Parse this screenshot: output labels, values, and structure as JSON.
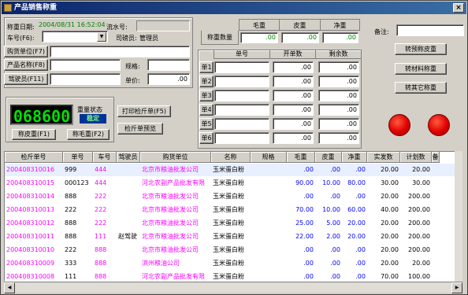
{
  "window": {
    "title": "产品销售称重",
    "close": "×"
  },
  "form": {
    "date_label": "称重日期:",
    "date_value": "2004/08/31 16:52:04",
    "serial_label": "流水号:",
    "serial_value": "",
    "car_label": "车号(F6):",
    "car_value": "",
    "operator_label": "司磅员:",
    "operator_value": "管理员",
    "buyer_label": "购货单位(F7)",
    "buyer_value": "",
    "product_label": "产品名称(F8)",
    "product_value": "",
    "spec_label": "规格:",
    "spec_value": "",
    "driver_label": "驾驶员(F11)",
    "driver_value": "",
    "price_label": "单价:",
    "price_value": ".00"
  },
  "weight_summary": {
    "headers": [
      "毛重",
      "皮重",
      "净重"
    ],
    "row_label": "称重数量",
    "values": [
      ".00",
      ".00",
      ".00"
    ]
  },
  "remark": {
    "label": "备注:",
    "value": ""
  },
  "detail_grid": {
    "headers": [
      "单号",
      "开单数",
      "剩余数"
    ],
    "rows": [
      {
        "label": "单1",
        "no": "",
        "open": ".00",
        "remain": ".00"
      },
      {
        "label": "单2",
        "no": "",
        "open": ".00",
        "remain": ".00"
      },
      {
        "label": "单3",
        "no": "",
        "open": ".00",
        "remain": ".00"
      },
      {
        "label": "单4",
        "no": "",
        "open": ".00",
        "remain": ".00"
      },
      {
        "label": "单5",
        "no": "",
        "open": ".00",
        "remain": ".00"
      },
      {
        "label": "单6",
        "no": "",
        "open": ".00",
        "remain": ".00"
      }
    ]
  },
  "scale": {
    "reading": "068600",
    "status_label": "重量状态",
    "status_value": "稳定",
    "tare_button": "称皮重(F1)",
    "gross_button": "称毛重(F2)"
  },
  "actions": {
    "print_ticket": "打印检斤单(F5)",
    "preview_ticket": "检斤单预览",
    "to_pre_tare": "转预称皮重",
    "to_material": "转材料称重",
    "to_other": "转其它称重"
  },
  "status_colors": {
    "light1": "#e00000",
    "light2": "#e00000",
    "lcd": "#00e000"
  },
  "records": {
    "columns": [
      "检斤单号",
      "单号",
      "车号",
      "驾驶员",
      "购货单位",
      "名称",
      "规格",
      "毛重",
      "皮重",
      "净重",
      "实发数",
      "计划数",
      "备"
    ],
    "rows": [
      {
        "ticket": "200408310016",
        "no": "999",
        "car": "444",
        "driver": "",
        "buyer": "北京市粮油批发公司",
        "name": "玉米蛋白粉",
        "spec": "",
        "gross": ".00",
        "tare": ".00",
        "net": ".00",
        "actual": "20.00",
        "plan": "20.00"
      },
      {
        "ticket": "200408310015",
        "no": "000123",
        "car": "444",
        "driver": "",
        "buyer": "河北农副产品批发有限",
        "name": "玉米蛋白粉",
        "spec": "",
        "gross": "90.00",
        "tare": "10.00",
        "net": "80.00",
        "actual": "30.00",
        "plan": "30.00"
      },
      {
        "ticket": "200408310014",
        "no": "888",
        "car": "222",
        "driver": "",
        "buyer": "北京市粮油批发公司",
        "name": "玉米蛋白粉",
        "spec": "",
        "gross": ".00",
        "tare": ".00",
        "net": ".00",
        "actual": "20.00",
        "plan": "200.00"
      },
      {
        "ticket": "200408310013",
        "no": "222",
        "car": "222",
        "driver": "",
        "buyer": "北京市粮油批发公司",
        "name": "玉米蛋白粉",
        "spec": "",
        "gross": "70.00",
        "tare": "10.00",
        "net": "60.00",
        "actual": "40.00",
        "plan": "200.00"
      },
      {
        "ticket": "200408310012",
        "no": "888",
        "car": "222",
        "driver": "",
        "buyer": "北京市粮油批发公司",
        "name": "玉米蛋白粉",
        "spec": "",
        "gross": "25.00",
        "tare": "5.00",
        "net": "20.00",
        "actual": "20.00",
        "plan": "200.00"
      },
      {
        "ticket": "200408310011",
        "no": "888",
        "car": "111",
        "driver": "赵驾驶",
        "buyer": "北京市粮油批发公司",
        "name": "玉米蛋白粉",
        "spec": "",
        "gross": "22.00",
        "tare": "2.00",
        "net": "20.00",
        "actual": "20.00",
        "plan": "200.00"
      },
      {
        "ticket": "200408310010",
        "no": "222",
        "car": "888",
        "driver": "",
        "buyer": "北京市粮油批发公司",
        "name": "玉米蛋白粉",
        "spec": "",
        "gross": ".00",
        "tare": ".00",
        "net": ".00",
        "actual": "20.00",
        "plan": "200.00"
      },
      {
        "ticket": "200408310009",
        "no": "333",
        "car": "888",
        "driver": "",
        "buyer": "滨州粮油公司",
        "name": "玉米蛋白粉",
        "spec": "",
        "gross": ".00",
        "tare": ".00",
        "net": ".00",
        "actual": "20.00",
        "plan": "20.00"
      },
      {
        "ticket": "200408310008",
        "no": "111",
        "car": "888",
        "driver": "",
        "buyer": "河北农副产品批发有限",
        "name": "玉米蛋白粉",
        "spec": "",
        "gross": ".00",
        "tare": ".00",
        "net": ".00",
        "actual": "70.00",
        "plan": "100.00"
      }
    ]
  }
}
